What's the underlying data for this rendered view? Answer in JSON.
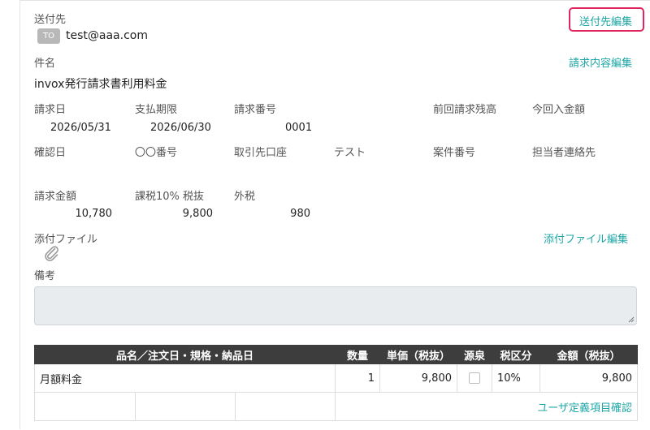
{
  "recipient": {
    "label": "送付先",
    "badge": "TO",
    "email": "test@aaa.com",
    "edit_link": "送付先編集"
  },
  "subject": {
    "label": "件名",
    "value": "invox発行請求書利用料金",
    "edit_link": "請求内容編集"
  },
  "fields": {
    "invoice_date_label": "請求日",
    "invoice_date": "2026/05/31",
    "due_date_label": "支払期限",
    "due_date": "2026/06/30",
    "invoice_no_label": "請求番号",
    "invoice_no": "0001",
    "prev_balance_label": "前回請求残高",
    "this_payment_label": "今回入金額",
    "confirm_date_label": "確認日",
    "oo_number_label": "〇〇番号",
    "account_label": "取引先口座",
    "test_label": "テスト",
    "project_no_label": "案件番号",
    "contact_label": "担当者連絡先"
  },
  "amounts": {
    "total_label": "請求金額",
    "total": "10,780",
    "taxable_label": "課税10% 税抜",
    "taxable": "9,800",
    "tax_label": "外税",
    "tax": "980"
  },
  "attachment": {
    "label": "添付ファイル",
    "edit_link": "添付ファイル編集",
    "icon": "paperclip-icon"
  },
  "notes": {
    "label": "備考",
    "value": ""
  },
  "items_table": {
    "headers": [
      "品名／注文日・規格・納品日",
      "数量",
      "単価（税抜）",
      "源泉",
      "税区分",
      "金額（税抜）"
    ],
    "rows": [
      {
        "name": "月額料金",
        "qty": "1",
        "unit_price": "9,800",
        "withholding": false,
        "tax_class": "10%",
        "amount": "9,800"
      }
    ],
    "custom_fields_link": "ユーザ定義項目確認"
  },
  "colors": {
    "accent": "#1fa6a6",
    "highlight": "#e0245e",
    "table_header": "#3d3d3d"
  }
}
